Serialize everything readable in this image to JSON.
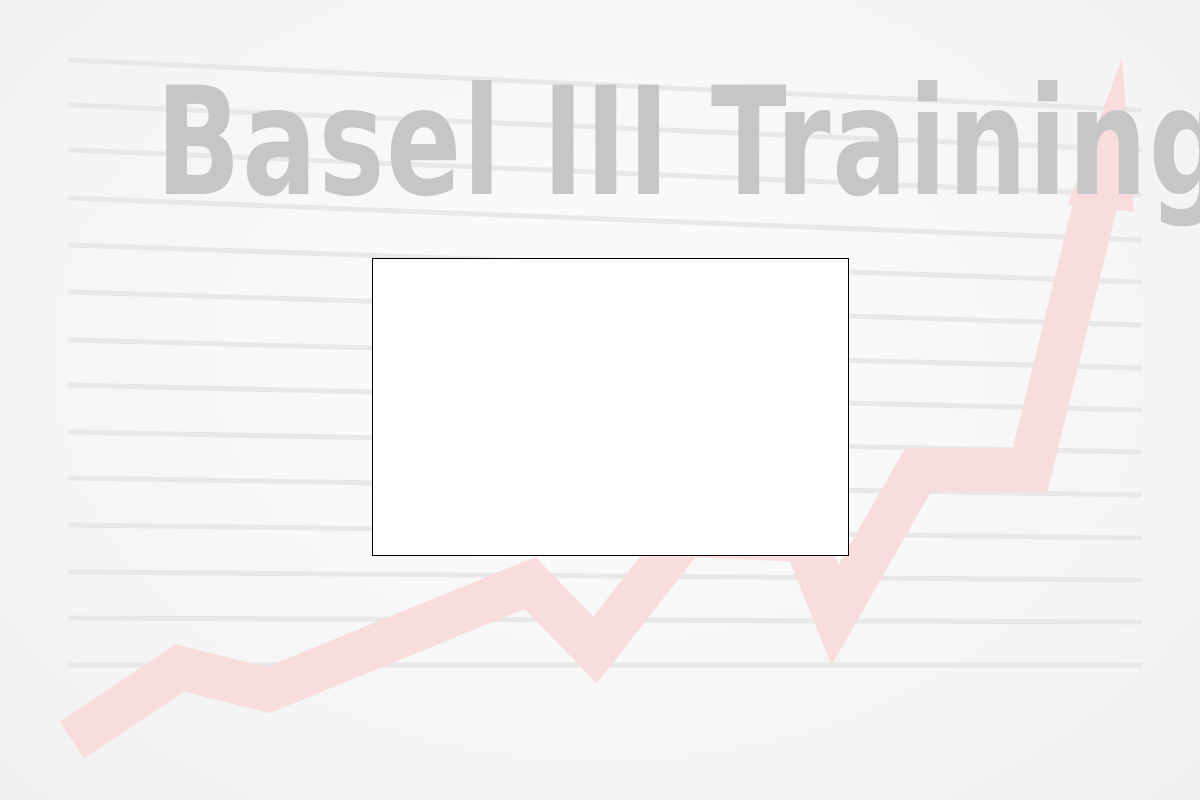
{
  "title": {
    "text": "Basel III Training",
    "color": "#c6c6c6"
  },
  "background": {
    "trend_arrow_color": "#f9dcdc",
    "ruled_line_color": "#e8e8e8"
  },
  "frame": {
    "border_color": "#000000",
    "fill_color": "#fefefe"
  }
}
